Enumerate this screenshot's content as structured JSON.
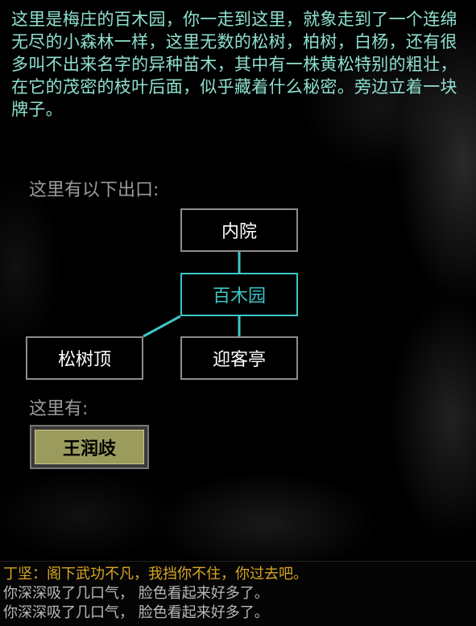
{
  "room": {
    "description": "这里是梅庄的百木园，你一走到这里，就象走到了一个连绵无尽的小森林一样，这里无数的松树，柏树，白杨，还有很多叫不出来名字的异种苗木，其中有一株黄松特别的粗壮，在它的茂密的枝叶后面，似乎藏着什么秘密。旁边立着一块牌子。"
  },
  "exits": {
    "label": "这里有以下出口:",
    "north": "内院",
    "current": "百木园",
    "southwest": "松树顶",
    "south": "迎客亭"
  },
  "occupants": {
    "label": "这里有:",
    "npcs": [
      "王润歧"
    ]
  },
  "chat": {
    "lines": [
      "丁坚：阁下武功不凡，我挡你不住，你过去吧。",
      "你深深吸了几口气，  脸色看起来好多了。",
      "你深深吸了几口气，  脸色看起来好多了。"
    ]
  },
  "colors": {
    "description_text": "#8fe0cf",
    "current_room": "#3fc6c6",
    "npc_button": "#9b9b5d",
    "speech_text": "#d9a622"
  }
}
